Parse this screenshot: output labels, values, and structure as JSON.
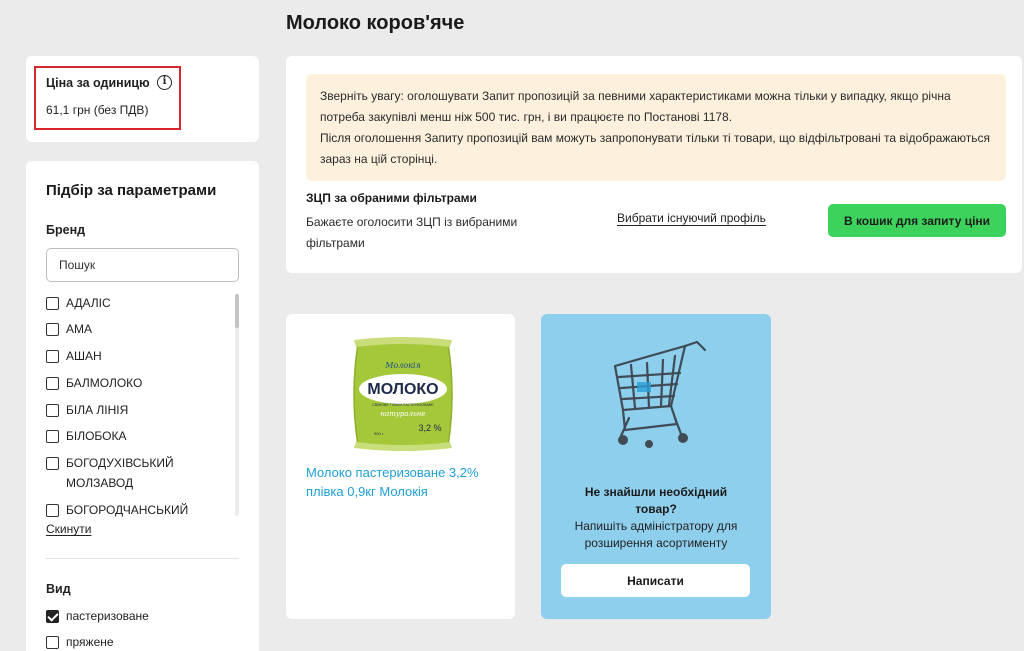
{
  "page": {
    "title": "Молоко коров'яче"
  },
  "price_card": {
    "label": "Ціна за одиницю",
    "info_icon": "info-circle-icon",
    "value": "61,1 грн (без ПДВ)",
    "highlight_color": "#d9262d"
  },
  "filters": {
    "title": "Підбір за параметрами",
    "brand_label": "Бренд",
    "search_placeholder": "Пошук",
    "brands": [
      {
        "label": "АДАЛІС",
        "checked": false
      },
      {
        "label": "АМА",
        "checked": false
      },
      {
        "label": "АШАН",
        "checked": false
      },
      {
        "label": "БАЛМОЛОКО",
        "checked": false
      },
      {
        "label": "БІЛА ЛІНІЯ",
        "checked": false
      },
      {
        "label": "БІЛОБОКА",
        "checked": false
      },
      {
        "label": "БОГОДУХІВСЬКИЙ МОЛЗАВОД",
        "checked": false
      },
      {
        "label": "БОГОРОДЧАНСЬКИЙ",
        "checked": false
      }
    ],
    "reset_label": "Скинути",
    "kind_label": "Вид",
    "kinds": [
      {
        "label": "пастеризоване",
        "checked": true
      },
      {
        "label": "пряжене",
        "checked": false
      }
    ]
  },
  "notice": {
    "paragraph_1": "Зверніть увагу: оголошувати Запит пропозицій за певними характеристиками можна тільки у випадку, якщо річна потреба закупівлі менш ніж 500 тис. грн, і ви працюєте по Постанові 1178.",
    "paragraph_2": "Після оголошення Запиту пропозицій вам можуть запропонувати тільки ті товари, що відфільтровані та відображаються зараз на цій сторінці.",
    "background_color": "#fdf1de"
  },
  "zcp": {
    "title": "ЗЦП за обраними фільтрами",
    "description": "Бажаєте оголосити ЗЦП із вибраними фільтрами",
    "profile_link": "Вибрати існуючий профіль",
    "cart_button": "В кошик для запиту ціни",
    "cart_button_color": "#3dd25c"
  },
  "product": {
    "name": "Молоко пастеризоване 3,2% плівка 0,9кг Молокія",
    "name_color": "#1f9fd6",
    "package": {
      "brand": "Молокія",
      "product": "МОЛОКО",
      "subtitle": "СВІЖОВЕ ТІЛЬКИ ПАСТЕРИЗОВАНЕ",
      "variant": "натуральне",
      "weight": "900 г",
      "fat": "3,2 %"
    }
  },
  "not_found": {
    "title": "Не знайшли необхідний товар?",
    "text": "Напишіть адміністратору для розширення асортименту",
    "button": "Написати",
    "background_color": "#8fcfee",
    "icon": "shopping-cart-icon"
  }
}
